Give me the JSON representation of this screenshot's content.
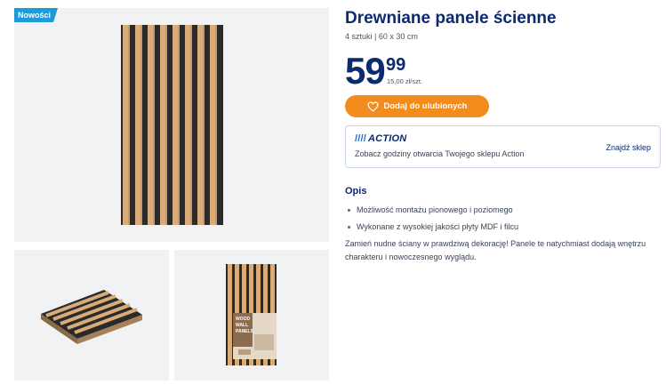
{
  "badge": "Nowości",
  "product": {
    "title": "Drewniane panele ścienne",
    "subtitle": "4 sztuki | 60 x 30 cm",
    "price_int": "59",
    "price_dec": "99",
    "price_unit": "15,00 zł/szt.",
    "favorite_label": "Dodaj do ulubionych"
  },
  "store": {
    "logo": "ACTION",
    "text": "Zobacz godziny otwarcia Twojego sklepu Action",
    "link": "Znajdź sklep"
  },
  "description": {
    "title": "Opis",
    "bullets": [
      "Możliwość montażu pionowego i poziomego",
      "Wykonane z wysokiej jakości płyty MDF i filcu"
    ],
    "text": "Zamień nudne ściany w prawdziwą dekorację! Panele te natychmiast dodają wnętrzu charakteru i nowoczesnego wyglądu."
  },
  "package_label": "WOOD WALL PANELS",
  "colors": {
    "accent_orange": "#f28c1c",
    "brand_blue": "#0c2a6e",
    "badge_blue": "#1e9bd6",
    "wood": "#d9ab78",
    "felt": "#2b2b2b"
  }
}
